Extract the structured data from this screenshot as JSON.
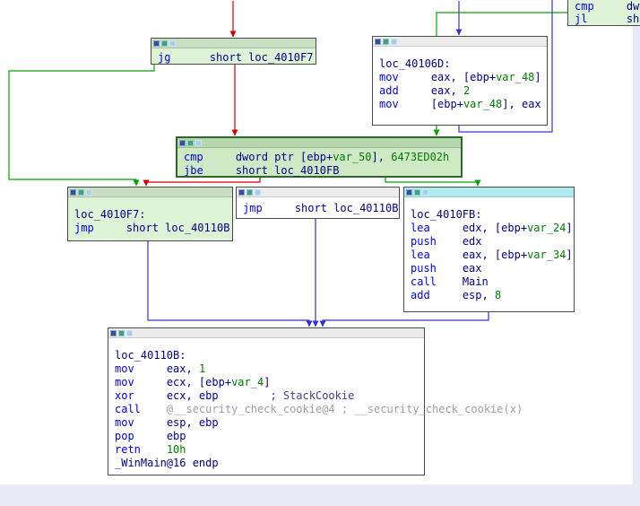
{
  "colors": {
    "canvas": "#ffffff",
    "outside": "#e9e9f7",
    "edge_true": "#0aa00a",
    "edge_false": "#d40000",
    "edge_jump": "#3434cc",
    "node_border": "#4a4a4a",
    "sel_border": "#2d672d",
    "node_green": "#def2d5",
    "node_green_sel": "#cfe9c5",
    "node_white": "#ffffff",
    "title_green": "#c8dfc2",
    "title_white": "#ececec",
    "title_cyan": "#aeeaee",
    "title_sel": "#b5d9ac",
    "tok_mn": "#0000dc",
    "tok_pl": "#00008b",
    "tok_grn": "#007c00",
    "tok_nm": "#000080",
    "tok_cm": "#414198",
    "tok_gy": "#a0a0a0",
    "icon_1": "#31519f",
    "icon_2": "#3f9f8f",
    "icon_3": "#a8cdec"
  },
  "icons": {
    "node_buttons": [
      "window-icon",
      "chart-icon",
      "color-swatch-icon"
    ]
  },
  "blocks": [
    {
      "id": "jl_partial",
      "label": "clipped conditional block (top right)",
      "lines": [
        [
          {
            "t": "cmp",
            "c": "mn"
          },
          {
            "t": "     ",
            "c": "pl"
          },
          {
            "t": "dwo",
            "c": "pl"
          }
        ],
        [
          {
            "t": "jl",
            "c": "mn"
          },
          {
            "t": "      ",
            "c": "pl"
          },
          {
            "t": "sho",
            "c": "pl"
          }
        ]
      ]
    },
    {
      "id": "jg",
      "label": "jg branch block",
      "lines": [
        [
          {
            "t": "jg",
            "c": "mn"
          },
          {
            "t": "      ",
            "c": "pl"
          },
          {
            "t": "short ",
            "c": "pl"
          },
          {
            "t": "loc_4010F7",
            "c": "nm"
          }
        ]
      ]
    },
    {
      "id": "loc_40106D",
      "label": "loc_40106D",
      "lines": [
        [
          {
            "t": "loc_40106D:",
            "c": "nm"
          }
        ],
        [
          {
            "t": "mov",
            "c": "mn"
          },
          {
            "t": "     ",
            "c": "pl"
          },
          {
            "t": "eax, [ebp+",
            "c": "pl"
          },
          {
            "t": "var_48",
            "c": "grn"
          },
          {
            "t": "]",
            "c": "pl"
          }
        ],
        [
          {
            "t": "add",
            "c": "mn"
          },
          {
            "t": "     ",
            "c": "pl"
          },
          {
            "t": "eax, ",
            "c": "pl"
          },
          {
            "t": "2",
            "c": "grn"
          }
        ],
        [
          {
            "t": "mov",
            "c": "mn"
          },
          {
            "t": "     ",
            "c": "pl"
          },
          {
            "t": "[ebp+",
            "c": "pl"
          },
          {
            "t": "var_48",
            "c": "grn"
          },
          {
            "t": "], eax",
            "c": "pl"
          }
        ]
      ]
    },
    {
      "id": "cmp_jbe",
      "label": "cmp / jbe block (selected)",
      "lines": [
        [
          {
            "t": "cmp",
            "c": "mn"
          },
          {
            "t": "     ",
            "c": "pl"
          },
          {
            "t": "dword ptr [ebp+",
            "c": "pl"
          },
          {
            "t": "var_50",
            "c": "grn"
          },
          {
            "t": "], ",
            "c": "pl"
          },
          {
            "t": "6473ED02h",
            "c": "grn"
          }
        ],
        [
          {
            "t": "jbe",
            "c": "mn"
          },
          {
            "t": "     ",
            "c": "pl"
          },
          {
            "t": "short ",
            "c": "pl"
          },
          {
            "t": "loc_4010FB",
            "c": "nm"
          }
        ]
      ]
    },
    {
      "id": "loc_4010F7",
      "label": "loc_4010F7",
      "lines": [
        [
          {
            "t": "loc_4010F7:",
            "c": "nm"
          }
        ],
        [
          {
            "t": "jmp",
            "c": "mn"
          },
          {
            "t": "     ",
            "c": "pl"
          },
          {
            "t": "short ",
            "c": "pl"
          },
          {
            "t": "loc_40110B",
            "c": "nm"
          }
        ]
      ]
    },
    {
      "id": "jmp_mid",
      "label": "jmp block",
      "lines": [
        [
          {
            "t": "jmp",
            "c": "mn"
          },
          {
            "t": "     ",
            "c": "pl"
          },
          {
            "t": "short ",
            "c": "pl"
          },
          {
            "t": "loc_40110B",
            "c": "nm"
          }
        ]
      ]
    },
    {
      "id": "loc_4010FB",
      "label": "loc_4010FB",
      "lines": [
        [
          {
            "t": "loc_4010FB:",
            "c": "nm"
          }
        ],
        [
          {
            "t": "lea",
            "c": "mn"
          },
          {
            "t": "     ",
            "c": "pl"
          },
          {
            "t": "edx, [ebp+",
            "c": "pl"
          },
          {
            "t": "var_24",
            "c": "grn"
          },
          {
            "t": "]",
            "c": "pl"
          }
        ],
        [
          {
            "t": "push",
            "c": "mn"
          },
          {
            "t": "    ",
            "c": "pl"
          },
          {
            "t": "edx",
            "c": "pl"
          }
        ],
        [
          {
            "t": "lea",
            "c": "mn"
          },
          {
            "t": "     ",
            "c": "pl"
          },
          {
            "t": "eax, [ebp+",
            "c": "pl"
          },
          {
            "t": "var_34",
            "c": "grn"
          },
          {
            "t": "]",
            "c": "pl"
          }
        ],
        [
          {
            "t": "push",
            "c": "mn"
          },
          {
            "t": "    ",
            "c": "pl"
          },
          {
            "t": "eax",
            "c": "pl"
          }
        ],
        [
          {
            "t": "call",
            "c": "mn"
          },
          {
            "t": "    ",
            "c": "pl"
          },
          {
            "t": "Main",
            "c": "nm"
          }
        ],
        [
          {
            "t": "add",
            "c": "mn"
          },
          {
            "t": "     ",
            "c": "pl"
          },
          {
            "t": "esp, ",
            "c": "pl"
          },
          {
            "t": "8",
            "c": "grn"
          }
        ]
      ]
    },
    {
      "id": "loc_40110B",
      "label": "loc_40110B (function exit)",
      "lines": [
        [
          {
            "t": "loc_40110B:",
            "c": "nm"
          }
        ],
        [
          {
            "t": "mov",
            "c": "mn"
          },
          {
            "t": "     ",
            "c": "pl"
          },
          {
            "t": "eax, ",
            "c": "pl"
          },
          {
            "t": "1",
            "c": "grn"
          }
        ],
        [
          {
            "t": "mov",
            "c": "mn"
          },
          {
            "t": "     ",
            "c": "pl"
          },
          {
            "t": "ecx, [ebp+",
            "c": "pl"
          },
          {
            "t": "var_4",
            "c": "grn"
          },
          {
            "t": "]",
            "c": "pl"
          }
        ],
        [
          {
            "t": "xor",
            "c": "mn"
          },
          {
            "t": "     ",
            "c": "pl"
          },
          {
            "t": "ecx, ebp",
            "c": "pl"
          },
          {
            "t": "        ",
            "c": "pl"
          },
          {
            "t": "; StackCookie",
            "c": "cm"
          }
        ],
        [
          {
            "t": "call",
            "c": "mn"
          },
          {
            "t": "    ",
            "c": "pl"
          },
          {
            "t": "@__security_check_cookie@4",
            "c": "gy"
          },
          {
            "t": " ",
            "c": "pl"
          },
          {
            "t": "; __security_check_cookie(x)",
            "c": "gy"
          }
        ],
        [
          {
            "t": "mov",
            "c": "mn"
          },
          {
            "t": "     ",
            "c": "pl"
          },
          {
            "t": "esp, ebp",
            "c": "pl"
          }
        ],
        [
          {
            "t": "pop",
            "c": "mn"
          },
          {
            "t": "     ",
            "c": "pl"
          },
          {
            "t": "ebp",
            "c": "pl"
          }
        ],
        [
          {
            "t": "retn",
            "c": "mn"
          },
          {
            "t": "    ",
            "c": "pl"
          },
          {
            "t": "10h",
            "c": "grn"
          }
        ],
        [
          {
            "t": "_WinMain@16 endp",
            "c": "nm"
          }
        ]
      ]
    }
  ]
}
